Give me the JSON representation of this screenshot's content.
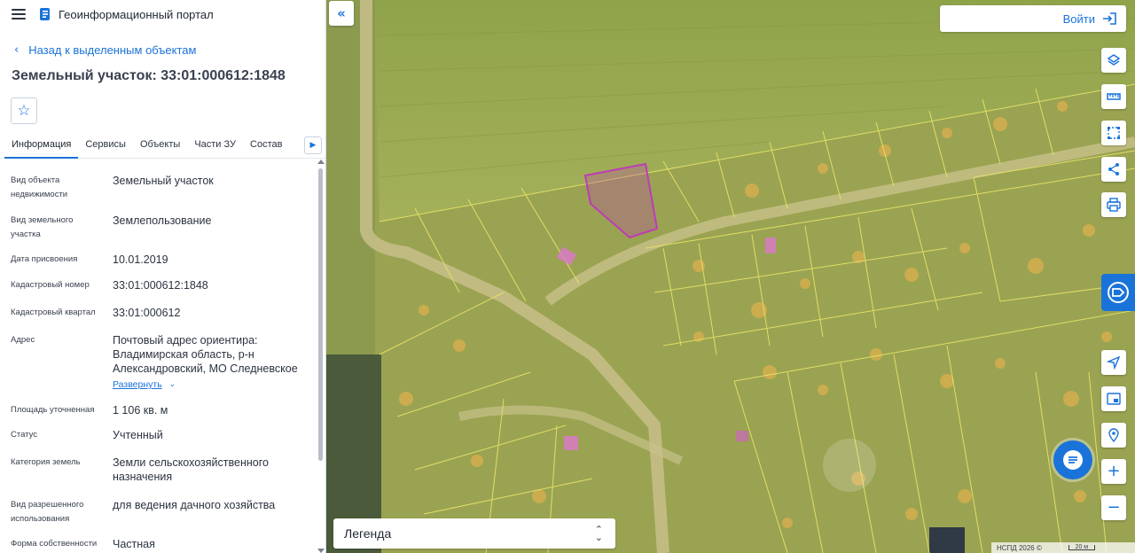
{
  "header": {
    "app_title": "Геоинформационный портал"
  },
  "panel": {
    "back_label": "Назад к выделенным объектам",
    "object_title": "Земельный участок: 33:01:000612:1848",
    "tabs": [
      {
        "label": "Информация",
        "active": true
      },
      {
        "label": "Сервисы",
        "active": false
      },
      {
        "label": "Объекты",
        "active": false
      },
      {
        "label": "Части ЗУ",
        "active": false
      },
      {
        "label": "Состав",
        "active": false
      }
    ],
    "fields": [
      {
        "label": "Вид объекта недвижимости",
        "value": "Земельный участок"
      },
      {
        "label": "Вид земельного участка",
        "value": "Землепользование"
      },
      {
        "label": "Дата присвоения",
        "value": "10.01.2019"
      },
      {
        "label": "Кадастровый номер",
        "value": "33:01:000612:1848"
      },
      {
        "label": "Кадастровый квартал",
        "value": "33:01:000612"
      },
      {
        "label": "Адрес",
        "value": "Почтовый адрес ориентира: Владимирская область, р-н Александровский, МО Следневское"
      },
      {
        "label": "Площадь уточненная",
        "value": "1 106 кв. м"
      },
      {
        "label": "Статус",
        "value": "Учтенный"
      },
      {
        "label": "Категория земель",
        "value": "Земли сельскохозяйственного назначения"
      },
      {
        "label": "Вид разрешенного использования",
        "value": "для ведения дачного хозяйства"
      },
      {
        "label": "Форма собственности",
        "value": "Частная"
      }
    ],
    "expand_label": "Развернуть"
  },
  "map": {
    "login_label": "Войти",
    "legend_label": "Легенда",
    "copyright": "НСПД 2026 ©",
    "scale_label": "20 м",
    "tools": [
      "layers-icon",
      "ruler-icon",
      "select-area-icon",
      "share-icon",
      "print-icon",
      "gosuslugi-icon",
      "locate-icon",
      "minimap-icon",
      "geo-pin-icon",
      "zoom-in-icon",
      "zoom-out-icon"
    ],
    "colors": {
      "accent": "#1a73d9",
      "parcel_highlight": "#c03ab8",
      "parcel_boundary": "#e8e46a"
    }
  }
}
